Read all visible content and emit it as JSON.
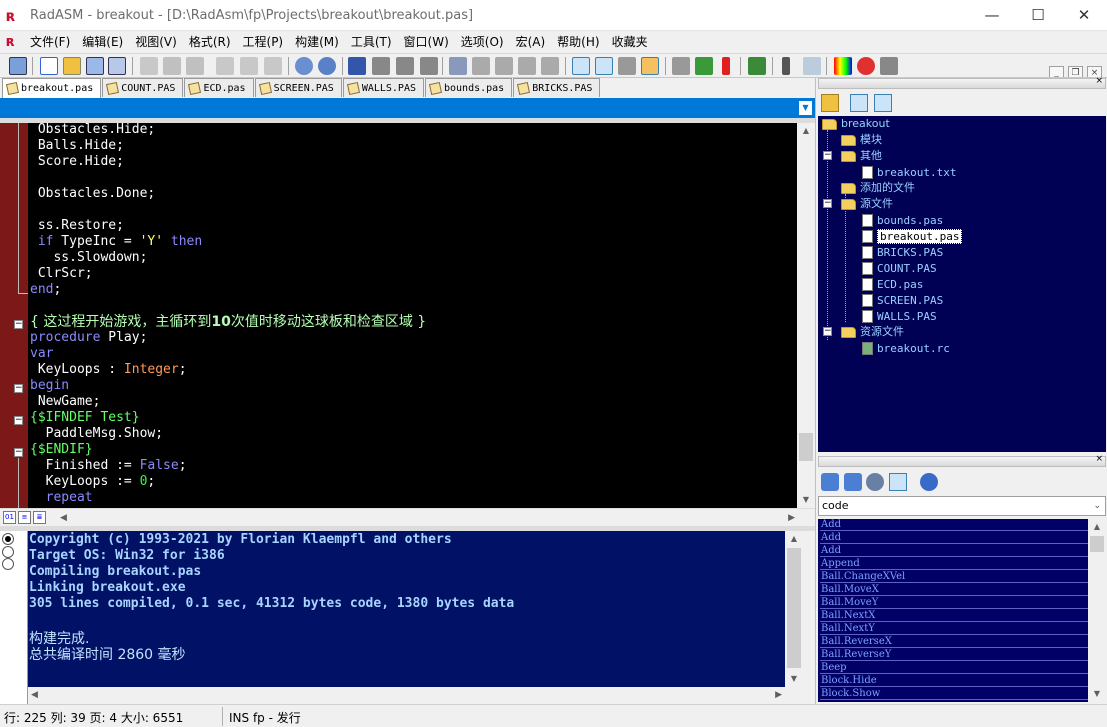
{
  "window": {
    "title": "RadASM - breakout - [D:\\RadAsm\\fp\\Projects\\breakout\\breakout.pas]",
    "minimize": "—",
    "maximize": "☐",
    "close": "✕"
  },
  "menu": [
    "文件(F)",
    "编辑(E)",
    "视图(V)",
    "格式(R)",
    "工程(P)",
    "构建(M)",
    "工具(T)",
    "窗口(W)",
    "选项(O)",
    "宏(A)",
    "帮助(H)",
    "收藏夹"
  ],
  "tabs": [
    "breakout.pas",
    "COUNT.PAS",
    "ECD.pas",
    "SCREEN.PAS",
    "WALLS.PAS",
    "bounds.pas",
    "BRICKS.PAS"
  ],
  "output": [
    "Copyright (c) 1993-2021 by Florian Klaempfl and others",
    "Target OS: Win32 for i386",
    "Compiling breakout.pas",
    "Linking breakout.exe",
    "305 lines compiled, 0.1 sec, 41312 bytes code, 1380 bytes data",
    "",
    "构建完成.",
    "总共编译时间 2860 毫秒"
  ],
  "tree": {
    "root": "breakout",
    "modules": "模块",
    "other": "其他",
    "other_file": "breakout.txt",
    "added": "添加的文件",
    "source": "源文件",
    "source_files": [
      "bounds.pas",
      "breakout.pas",
      "BRICKS.PAS",
      "COUNT.PAS",
      "ECD.pas",
      "SCREEN.PAS",
      "WALLS.PAS"
    ],
    "resources": "资源文件",
    "resource_file": "breakout.rc"
  },
  "code_select": "code",
  "code_list": [
    "Add",
    "Add",
    "Add",
    "Append",
    "Ball.ChangeXVel",
    "Ball.MoveX",
    "Ball.MoveY",
    "Ball.NextX",
    "Ball.NextY",
    "Ball.ReverseX",
    "Ball.ReverseY",
    "Beep",
    "Block.Hide",
    "Block.Show"
  ],
  "status": {
    "position": "行: 225  列:  39 页: 4 大小: 6551",
    "mode": "INS fp - 发行"
  }
}
